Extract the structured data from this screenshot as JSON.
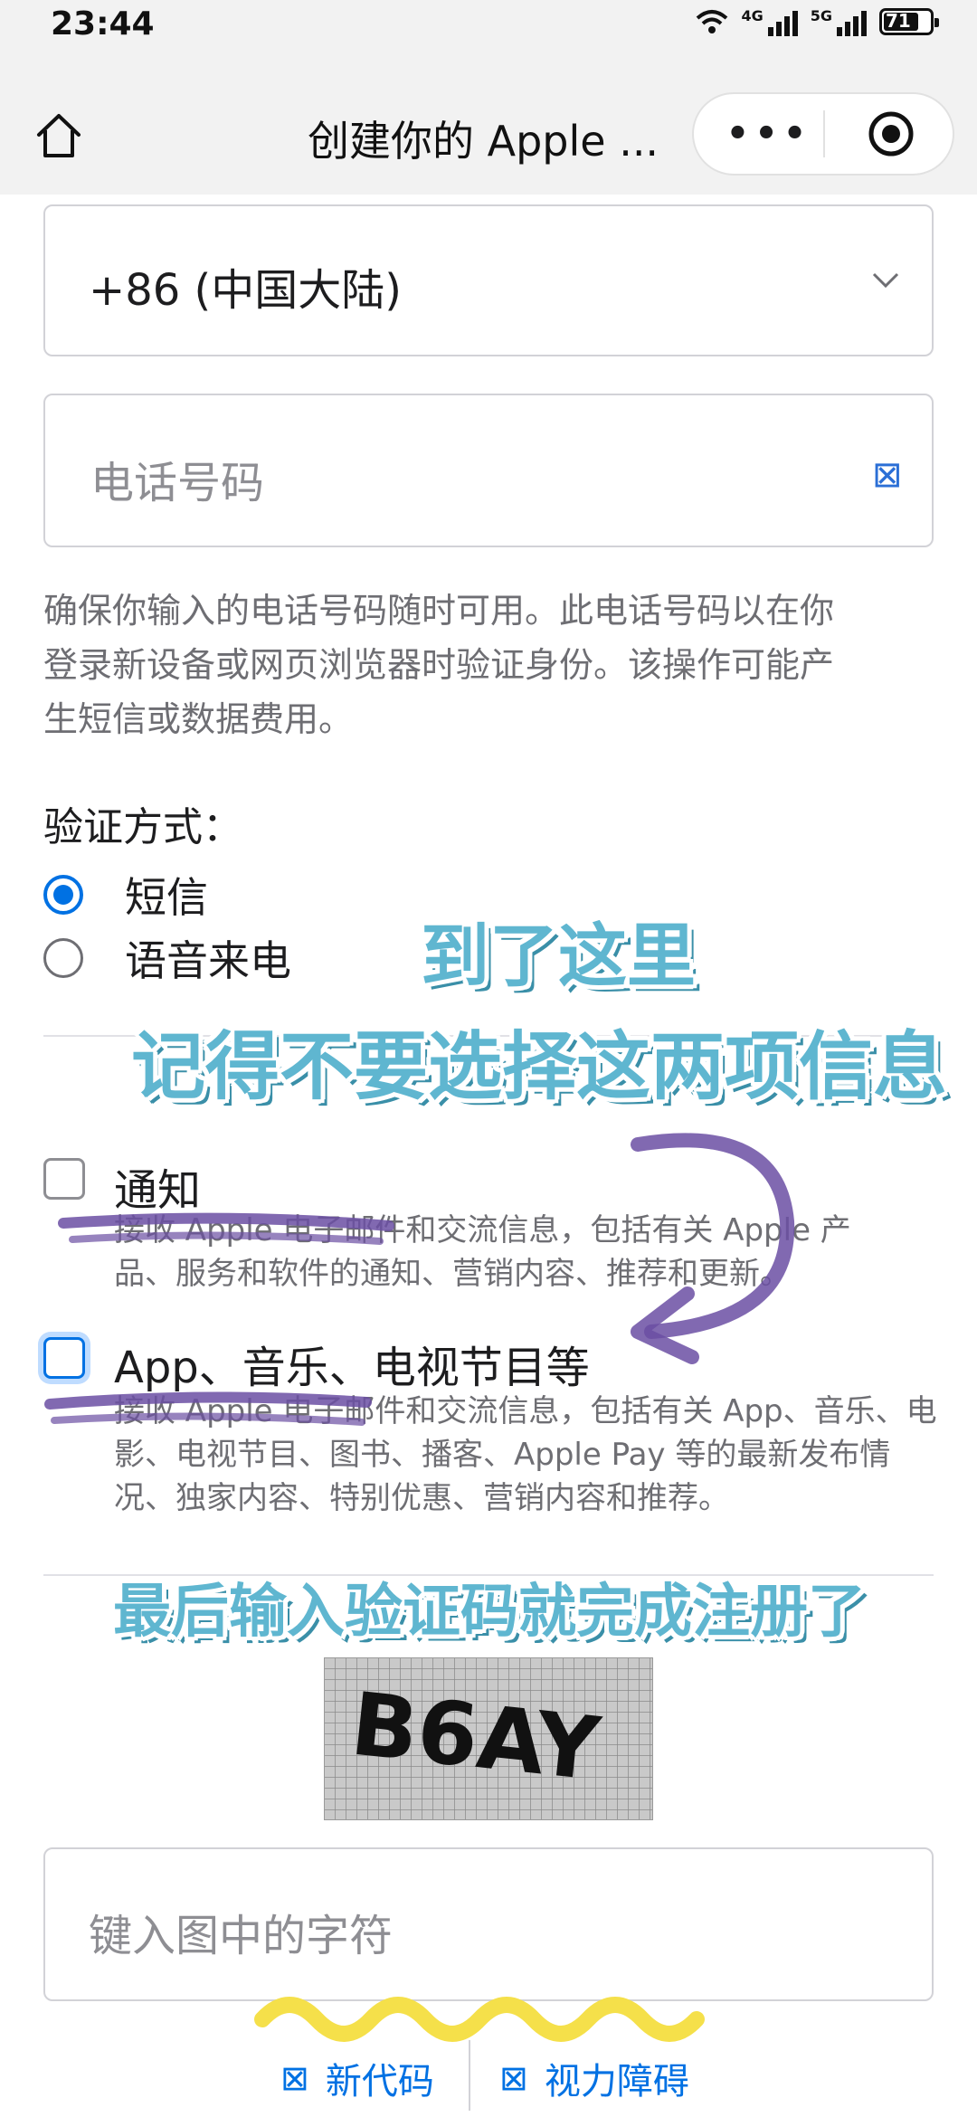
{
  "status_bar": {
    "time": "23:44",
    "net1": "4G",
    "net2": "5G",
    "battery": "71"
  },
  "nav": {
    "title": "创建你的 Apple ...",
    "more_glyph": "•••"
  },
  "form": {
    "country_code": "+86 (中国大陆)",
    "phone_placeholder": "电话号码",
    "phone_description": "确保你输入的电话号码随时可用。此电话号码以在你登录新设备或网页浏览器时验证身份。该操作可能产生短信或数据费用。",
    "verify_label": "验证方式：",
    "verify_options": [
      {
        "label": "短信",
        "selected": true
      },
      {
        "label": "语音来电",
        "selected": false
      }
    ],
    "subscriptions": [
      {
        "title": "通知",
        "description": "接收 Apple 电子邮件和交流信息，包括有关 Apple 产品、服务和软件的通知、营销内容、推荐和更新。",
        "checked": false
      },
      {
        "title": "App、音乐、电视节目等",
        "description": "接收 Apple 电子邮件和交流信息，包括有关 App、音乐、电影、电视节目、图书、播客、Apple Pay 等的最新发布情况、独家内容、特别优惠、营销内容和推荐。",
        "checked": false
      }
    ],
    "captcha_text": "B6AY",
    "code_placeholder": "键入图中的字符",
    "new_code_label": "新代码",
    "vision_label": "视力障碍"
  },
  "annotations": {
    "line1": "到了这里",
    "line2": "记得不要选择这两项信息",
    "line3": "最后输入验证码就完成注册了"
  },
  "colors": {
    "accent": "#0071e3",
    "annotation": "#5fb6d0",
    "strike": "#6b4fa3",
    "highlight": "#f5e04a"
  }
}
